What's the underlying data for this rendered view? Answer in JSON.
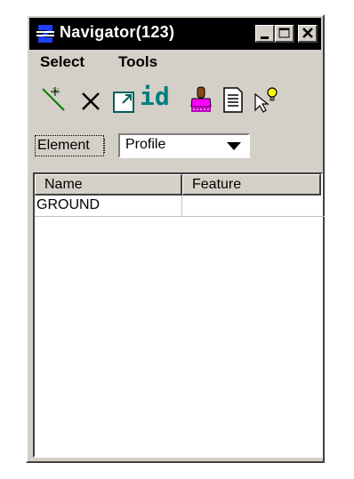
{
  "window": {
    "title": "Navigator(123)"
  },
  "menu": {
    "select": "Select",
    "tools": "Tools"
  },
  "toolbar": {
    "id_label": "id"
  },
  "element": {
    "label": "Element",
    "selected": "Profile"
  },
  "table": {
    "columns": [
      "Name",
      "Feature"
    ],
    "rows": [
      {
        "name": "GROUND",
        "feature": ""
      }
    ]
  }
}
